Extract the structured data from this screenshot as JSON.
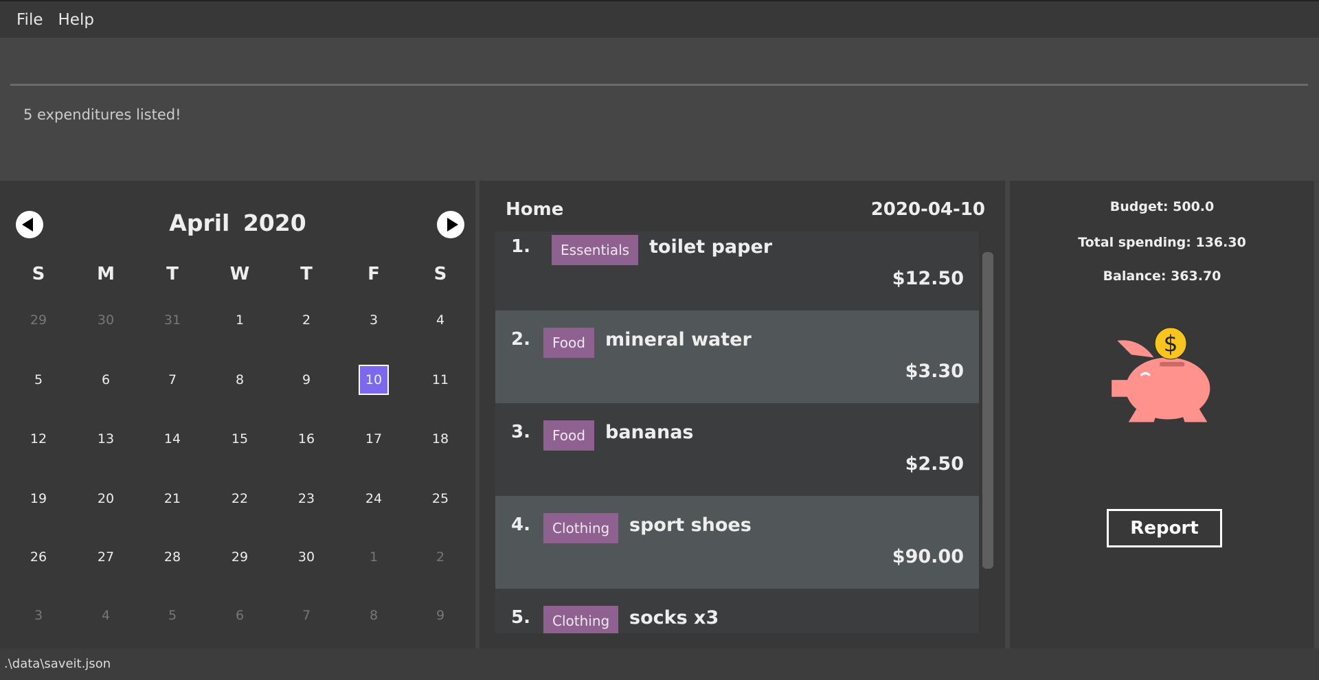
{
  "menu": {
    "file": "File",
    "help": "Help"
  },
  "command": {
    "value": "",
    "placeholder": ""
  },
  "result_text": "5 expenditures listed!",
  "calendar": {
    "title": "April  2020",
    "weekdays": [
      "S",
      "M",
      "T",
      "W",
      "T",
      "F",
      "S"
    ],
    "weeks": [
      [
        "29",
        "30",
        "31",
        "1",
        "2",
        "3",
        "4"
      ],
      [
        "5",
        "6",
        "7",
        "8",
        "9",
        "10",
        "11"
      ],
      [
        "12",
        "13",
        "14",
        "15",
        "16",
        "17",
        "18"
      ],
      [
        "19",
        "20",
        "21",
        "22",
        "23",
        "24",
        "25"
      ],
      [
        "26",
        "27",
        "28",
        "29",
        "30",
        "1",
        "2"
      ],
      [
        "3",
        "4",
        "5",
        "6",
        "7",
        "8",
        "9"
      ]
    ],
    "selected": "10",
    "selected_color": "#7b68ee"
  },
  "list": {
    "title": "Home",
    "date": "2020-04-10",
    "items": [
      {
        "num": "1.",
        "tag": "Essentials",
        "desc": "toilet paper",
        "amount": "$12.50"
      },
      {
        "num": "2.",
        "tag": "Food",
        "desc": "mineral water",
        "amount": "$3.30"
      },
      {
        "num": "3.",
        "tag": "Food",
        "desc": "bananas",
        "amount": "$2.50"
      },
      {
        "num": "4.",
        "tag": "Clothing",
        "desc": "sport shoes",
        "amount": "$90.00"
      },
      {
        "num": "5.",
        "tag": "Clothing",
        "desc": "socks x3",
        "amount": ""
      }
    ],
    "tag_color": "#8e6190"
  },
  "side": {
    "budget": "Budget: 500.0",
    "total": "Total spending: 136.30",
    "balance": "Balance: 363.70",
    "report": "Report",
    "image": "piggy-bank-icon"
  },
  "status": ".\\data\\saveit.json"
}
